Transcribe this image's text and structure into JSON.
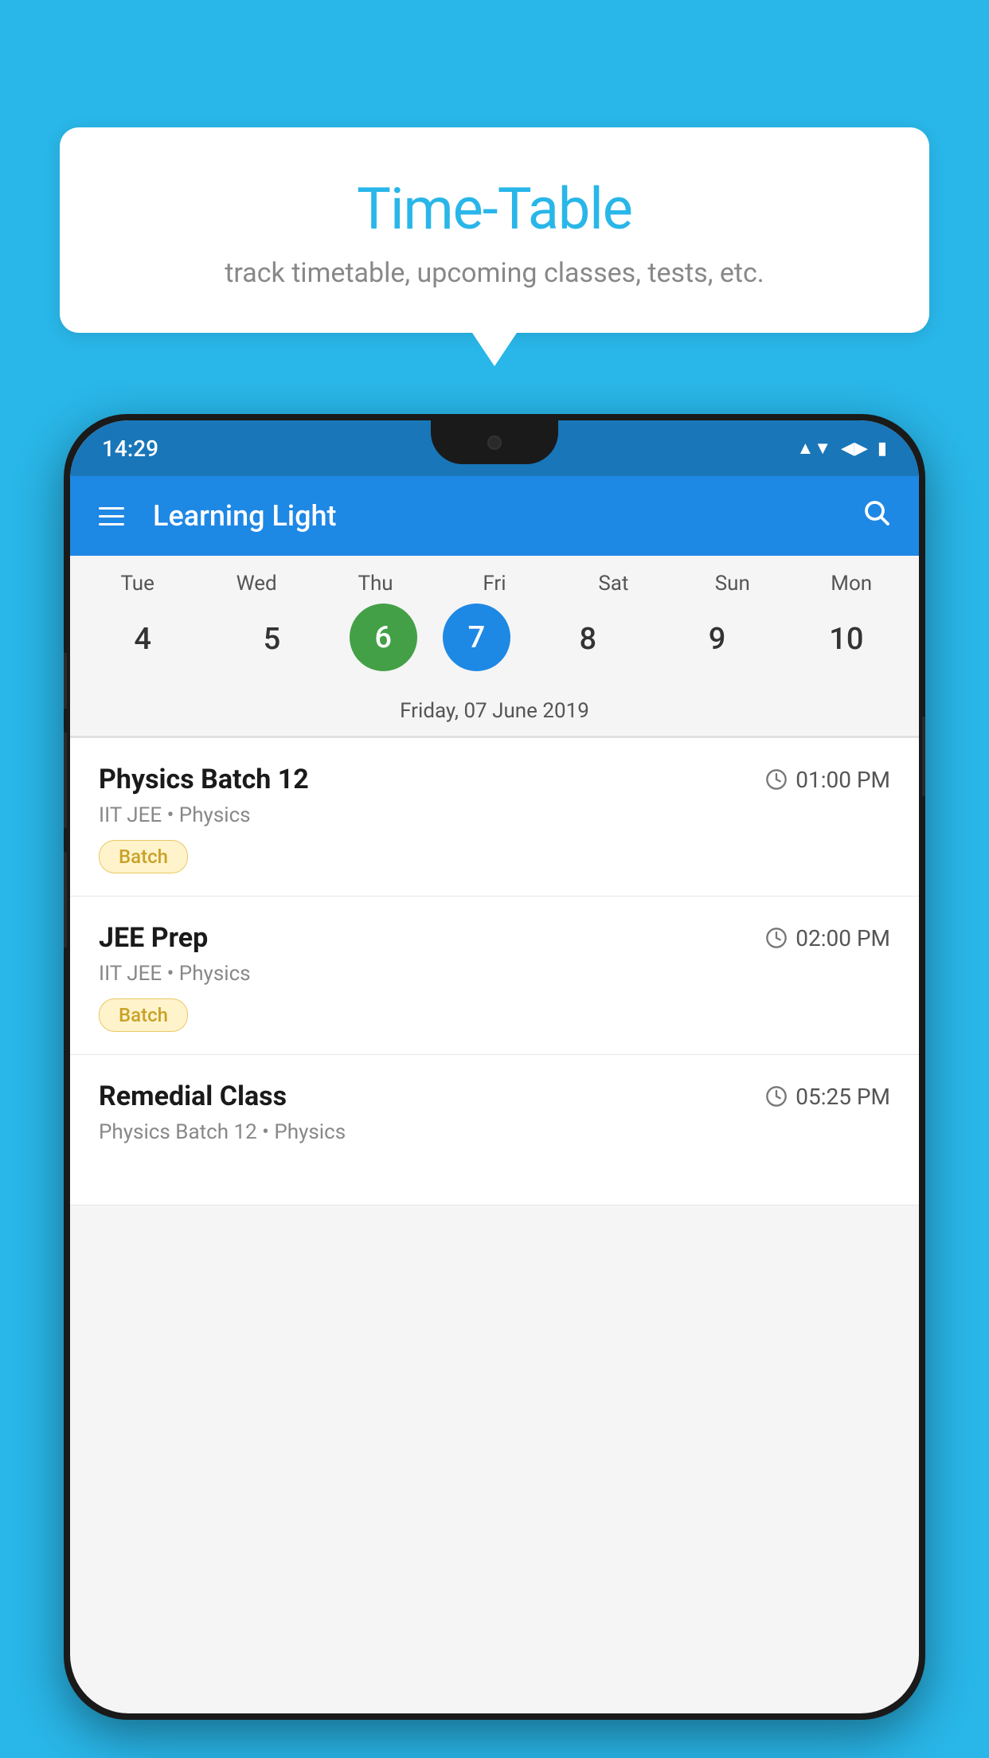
{
  "page": {
    "background_color": "#29b6e8"
  },
  "speech_bubble": {
    "title": "Time-Table",
    "subtitle": "track timetable, upcoming classes, tests, etc."
  },
  "status_bar": {
    "time": "14:29"
  },
  "toolbar": {
    "app_name": "Learning Light",
    "menu_icon": "menu-icon",
    "search_icon": "search-icon"
  },
  "calendar": {
    "days": [
      {
        "label": "Tue",
        "number": "4"
      },
      {
        "label": "Wed",
        "number": "5"
      },
      {
        "label": "Thu",
        "number": "6",
        "state": "today"
      },
      {
        "label": "Fri",
        "number": "7",
        "state": "selected"
      },
      {
        "label": "Sat",
        "number": "8"
      },
      {
        "label": "Sun",
        "number": "9"
      },
      {
        "label": "Mon",
        "number": "10"
      }
    ],
    "selected_date_label": "Friday, 07 June 2019"
  },
  "classes": [
    {
      "name": "Physics Batch 12",
      "time": "01:00 PM",
      "meta": "IIT JEE • Physics",
      "badge": "Batch"
    },
    {
      "name": "JEE Prep",
      "time": "02:00 PM",
      "meta": "IIT JEE • Physics",
      "badge": "Batch"
    },
    {
      "name": "Remedial Class",
      "time": "05:25 PM",
      "meta": "Physics Batch 12 • Physics",
      "badge": null
    }
  ]
}
